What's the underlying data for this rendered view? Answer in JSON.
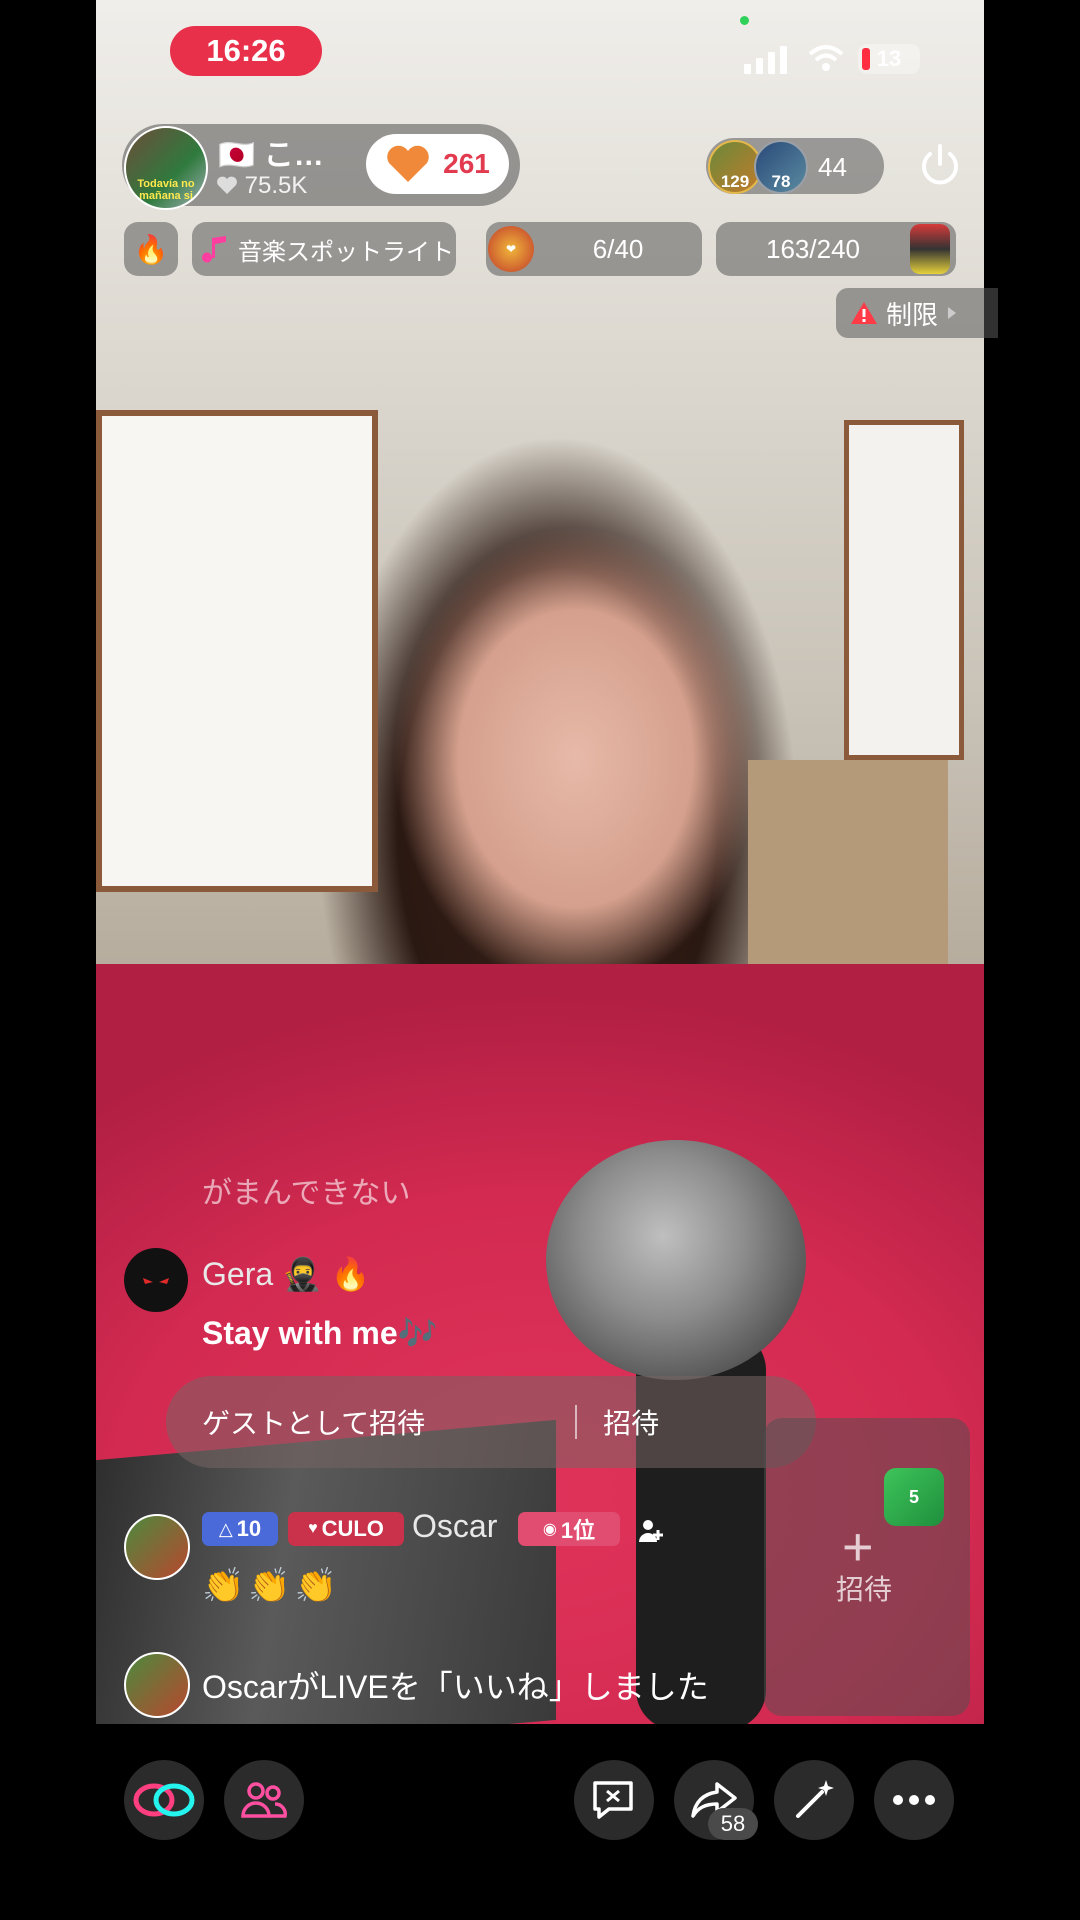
{
  "status_bar": {
    "time": "16:26",
    "battery": "13"
  },
  "host": {
    "name": "こ…",
    "flag": "🇯🇵",
    "likes": "75.5K",
    "avatar_text": "Todavía no mañana si",
    "like_count": "261"
  },
  "viewers": {
    "v1": "129",
    "v2": "78",
    "count": "44"
  },
  "top_row": {
    "fire": "🔥",
    "music_label": "音楽スポットライト",
    "rank_value": "6/40",
    "goal_value": "163/240"
  },
  "limit": {
    "label": "制限"
  },
  "comments": {
    "faded": "がまんできない",
    "gera_name": "Gera 🥷 🔥",
    "gera_message": "Stay with me🎶",
    "invite_guest": "ゲストとして招待",
    "invite": "招待",
    "oscar_level": "10",
    "oscar_fan_badge": "CULO",
    "oscar_name": "Oscar",
    "oscar_rank": "1位",
    "oscar_message": "👏👏👏",
    "like_notice": "OscarがLIVEを「いいね」しました"
  },
  "guest_panel": {
    "plus": "+",
    "label": "招待",
    "frog_badge": "5"
  },
  "bottom_bar": {
    "share_count": "58"
  }
}
